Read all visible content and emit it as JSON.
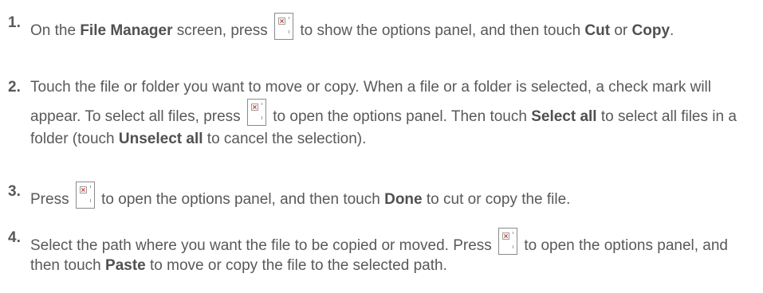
{
  "steps": [
    {
      "number": "1.",
      "t1": "On the ",
      "b1": "File Manager",
      "t2": " screen, press ",
      "t3": " to show the options panel, and then touch ",
      "b2": "Cut",
      "t4": " or ",
      "b3": "Copy",
      "t5": "."
    },
    {
      "number": "2.",
      "t1": "Touch the file or folder you want to move or copy. When a file or a folder is selected, a check mark will appear. To select all files, press ",
      "t2": " to open the options panel. Then touch ",
      "b1": "Select all",
      "t3": " to select all files in a folder (touch ",
      "b2": "Unselect all",
      "t4": " to cancel the selection)."
    },
    {
      "number": "3.",
      "t1": "Press ",
      "t2": " to open the options panel, and then touch ",
      "b1": "Done",
      "t3": " to cut or copy the file."
    },
    {
      "number": "4.",
      "t1": "Select the path where you want the file to be copied or moved. Press ",
      "t2": " to open the options panel, and then touch ",
      "b1": "Paste",
      "t3": " to move or copy the file to the selected path."
    }
  ],
  "icons": {
    "menu_key": "menu-key-icon"
  },
  "colors": {
    "text": "#58595b",
    "icon_x": "#c0392b"
  }
}
